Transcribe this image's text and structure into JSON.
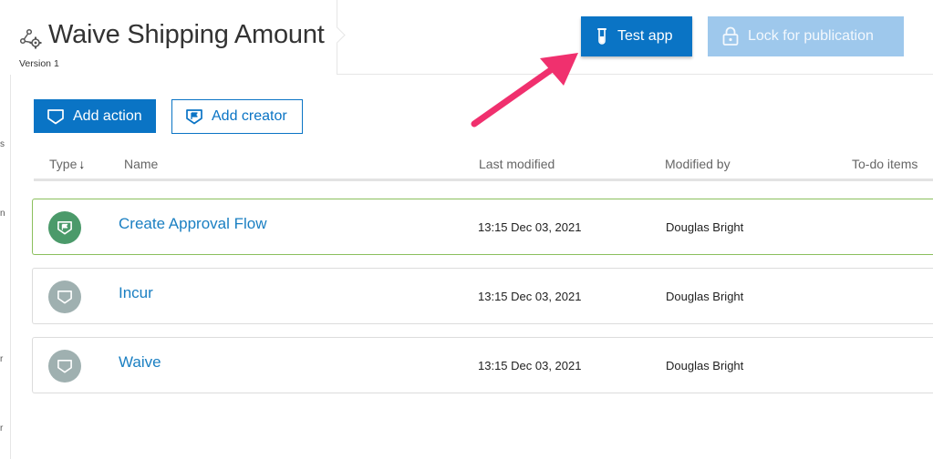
{
  "header": {
    "title": "Waive Shipping Amount",
    "version": "Version 1",
    "test_app_label": "Test app",
    "lock_label": "Lock for publication"
  },
  "toolbar": {
    "add_action_label": "Add action",
    "add_creator_label": "Add creator"
  },
  "table": {
    "columns": [
      "Type",
      "Name",
      "Last modified",
      "Modified by",
      "To-do items"
    ],
    "type_sort_indicator": "↓",
    "rows": [
      {
        "type": "creator",
        "name": "Create Approval Flow",
        "last_modified": "13:15 Dec 03, 2021",
        "modified_by": "Douglas Bright",
        "selected": true
      },
      {
        "type": "action",
        "name": "Incur",
        "last_modified": "13:15 Dec 03, 2021",
        "modified_by": "Douglas Bright",
        "selected": false
      },
      {
        "type": "action",
        "name": "Waive",
        "last_modified": "13:15 Dec 03, 2021",
        "modified_by": "Douglas Bright",
        "selected": false
      }
    ]
  },
  "left_rail_fragments": [
    "s",
    "n",
    "r",
    "r"
  ],
  "colors": {
    "primary": "#0a74c5",
    "primary_disabled": "#9ec8ec",
    "link": "#1a7fc2",
    "selected_border": "#8bbf5d",
    "creator_icon": "#4b9a6a",
    "action_icon": "#9fb0b0",
    "annotation_arrow": "#f0306e"
  }
}
